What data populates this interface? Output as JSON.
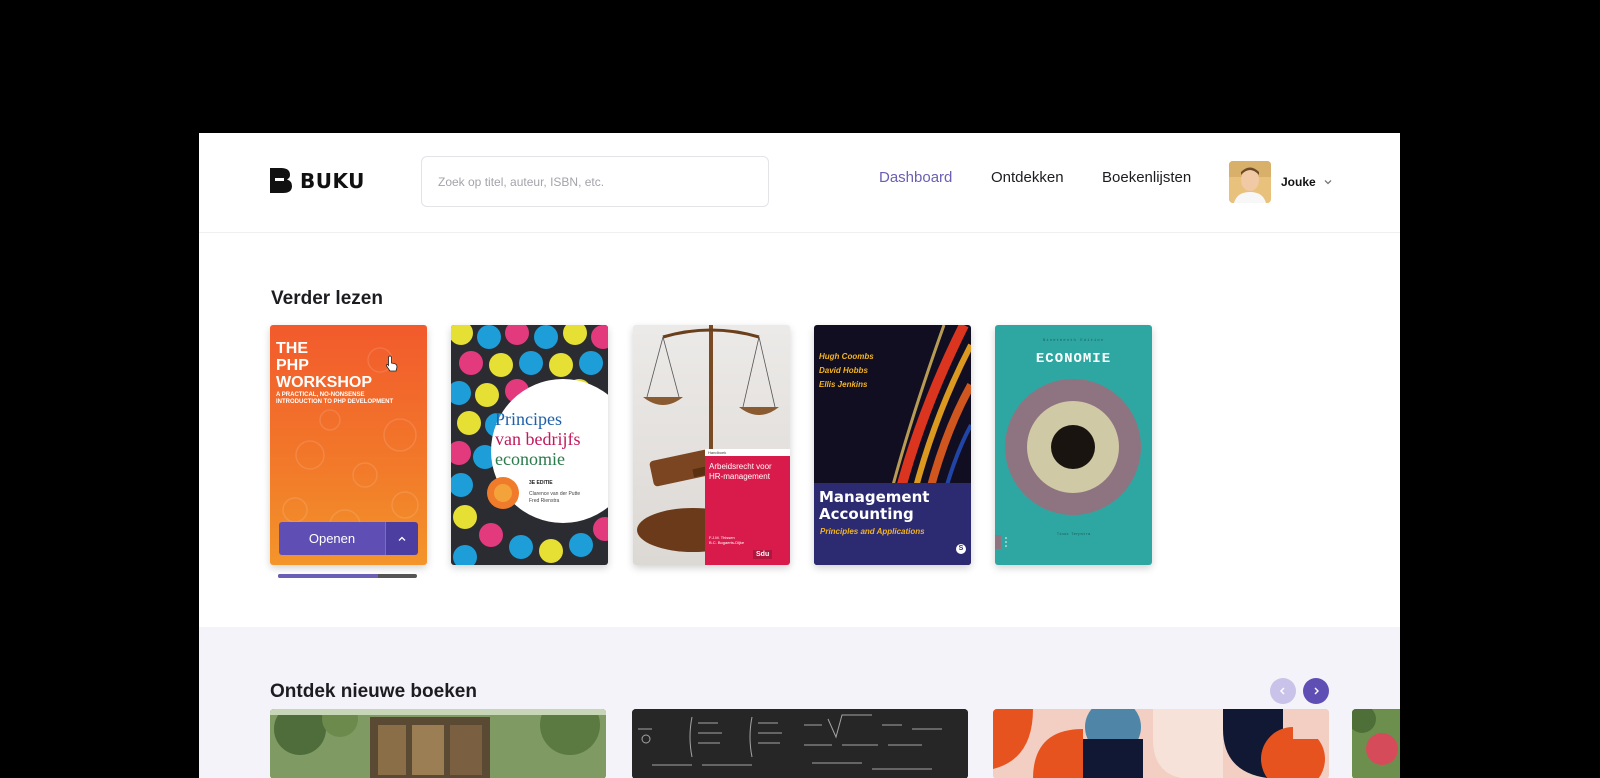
{
  "app": {
    "name": "BUKU"
  },
  "search": {
    "placeholder": "Zoek op titel, auteur, ISBN, etc."
  },
  "nav": {
    "dashboard": "Dashboard",
    "discover": "Ontdekken",
    "booklists": "Boekenlijsten"
  },
  "user": {
    "name": "Jouke"
  },
  "continue_reading": {
    "title": "Verder lezen",
    "open_label": "Openen",
    "progress_fraction": 0.72,
    "books": [
      {
        "title_lines": [
          "THE",
          "PHP",
          "WORKSHOP"
        ],
        "subtitle_lines": [
          "A PRACTICAL, NO-NONSENSE",
          "INTRODUCTION TO PHP DEVELOPMENT"
        ],
        "color": "#f2652a"
      },
      {
        "title_lines": [
          "Principes",
          "van bedrijfs",
          "economie"
        ],
        "edition": "3E EDITIE",
        "authors": [
          "Clarence van der Putte",
          "Fred Rienstra"
        ]
      },
      {
        "series": "Handboek",
        "title_lines": [
          "Arbeidsrecht voor",
          "HR-management"
        ],
        "authors": [
          "F.J.M. Thissen",
          "B.C. Bogaerts-Dijke"
        ],
        "publisher": "Sdu"
      },
      {
        "authors": [
          "Hugh Coombs",
          "David Hobbs",
          "Ellis Jenkins"
        ],
        "title_lines": [
          "Management",
          "Accounting"
        ],
        "subtitle": "Principles and Applications",
        "publisher": "S"
      },
      {
        "top": "Nineteenth Edition",
        "title": "ECONOMIE",
        "bottom": "Tinus Terpstra"
      }
    ]
  },
  "discover": {
    "title": "Ontdek nieuwe boeken"
  },
  "colors": {
    "accent": "#6a5fb4",
    "accent_dark": "#5f4fb4",
    "band": "#f4f3f9"
  }
}
